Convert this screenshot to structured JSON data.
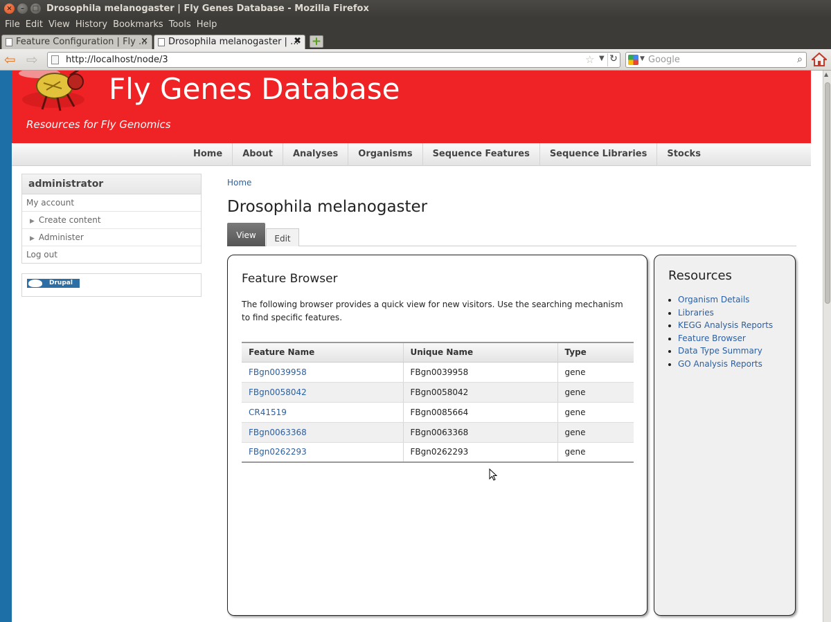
{
  "window": {
    "title": "Drosophila melanogaster | Fly Genes Database - Mozilla Firefox",
    "controls": {
      "close": "×",
      "minimize": "–",
      "maximize": "□"
    }
  },
  "menu": [
    "File",
    "Edit",
    "View",
    "History",
    "Bookmarks",
    "Tools",
    "Help"
  ],
  "tabs": [
    {
      "label": "Feature Configuration | Fly ..."
    },
    {
      "label": "Drosophila melanogaster | ..."
    }
  ],
  "navigation": {
    "url": "http://localhost/node/3",
    "search_placeholder": "Google"
  },
  "site": {
    "name": "Fly Genes Database",
    "slogan": "Resources for Fly Genomics",
    "header_color": "#ef2225"
  },
  "primary_nav": [
    "Home",
    "About",
    "Analyses",
    "Organisms",
    "Sequence Features",
    "Sequence Libraries",
    "Stocks"
  ],
  "sidebar": {
    "user_block_title": "administrator",
    "links": [
      "My account",
      "Create content",
      "Administer",
      "Log out"
    ],
    "powered_by": "Drupal"
  },
  "main": {
    "breadcrumb": "Home",
    "title": "Drosophila melanogaster",
    "tabs": [
      "View",
      "Edit"
    ]
  },
  "feature_browser": {
    "title": "Feature Browser",
    "description": "The following browser provides a quick view for new visitors. Use the searching mechanism to find specific features.",
    "columns": [
      "Feature Name",
      "Unique Name",
      "Type"
    ],
    "rows": [
      [
        "FBgn0039958",
        "FBgn0039958",
        "gene"
      ],
      [
        "FBgn0058042",
        "FBgn0058042",
        "gene"
      ],
      [
        "CR41519",
        "FBgn0085664",
        "gene"
      ],
      [
        "FBgn0063368",
        "FBgn0063368",
        "gene"
      ],
      [
        "FBgn0262293",
        "FBgn0262293",
        "gene"
      ]
    ]
  },
  "resources": {
    "title": "Resources",
    "links": [
      "Organism Details",
      "Libraries",
      "KEGG Analysis Reports",
      "Feature Browser",
      "Data Type Summary",
      "GO Analysis Reports"
    ]
  },
  "icons": [
    "fly-logo-icon",
    "back-arrow-icon",
    "forward-arrow-icon",
    "bookmark-star-icon",
    "reload-icon",
    "search-magnifier-icon",
    "home-icon",
    "new-tab-icon",
    "document-icon",
    "drupal-icon",
    "mouse-cursor-icon"
  ]
}
